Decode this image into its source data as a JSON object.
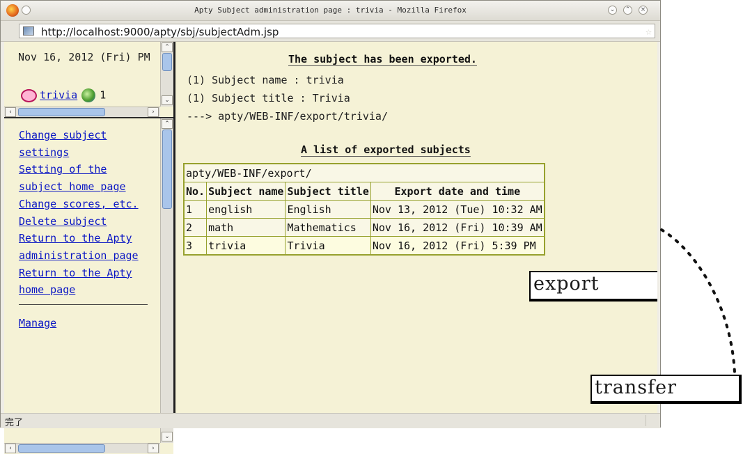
{
  "window": {
    "title": "Apty Subject administration page : trivia - Mozilla Firefox",
    "url": "http://localhost:9000/apty/sbj/subjectAdm.jsp",
    "status": "完了"
  },
  "sidebar_top": {
    "date": "Nov 16, 2012 (Fri) PM",
    "user_link": "trivia",
    "count": "1"
  },
  "menu": {
    "items": [
      "Change subject settings",
      "Setting of the subject home page",
      "Change scores, etc.",
      "Delete subject",
      "Return to the Apty administration page",
      "Return to the Apty home page"
    ],
    "after_separator": "Manage"
  },
  "main": {
    "export_heading": "The subject has been exported.",
    "name_line": "(1) Subject name : trivia",
    "title_line": "(1) Subject title : Trivia",
    "path_line": "---> apty/WEB-INF/export/trivia/",
    "list_heading": "A list of exported subjects",
    "table": {
      "path": "apty/WEB-INF/export/",
      "headers": [
        "No.",
        "Subject name",
        "Subject title",
        "Export date and time"
      ],
      "rows": [
        [
          "1",
          "english",
          "English",
          "Nov 13, 2012 (Tue) 10:32 AM"
        ],
        [
          "2",
          "math",
          "Mathematics",
          "Nov 16, 2012 (Fri) 10:39 AM"
        ],
        [
          "3",
          "trivia",
          "Trivia",
          "Nov 16, 2012 (Fri) 5:39 PM"
        ]
      ]
    }
  },
  "annotations": {
    "export": "export",
    "transfer": "transfer"
  }
}
